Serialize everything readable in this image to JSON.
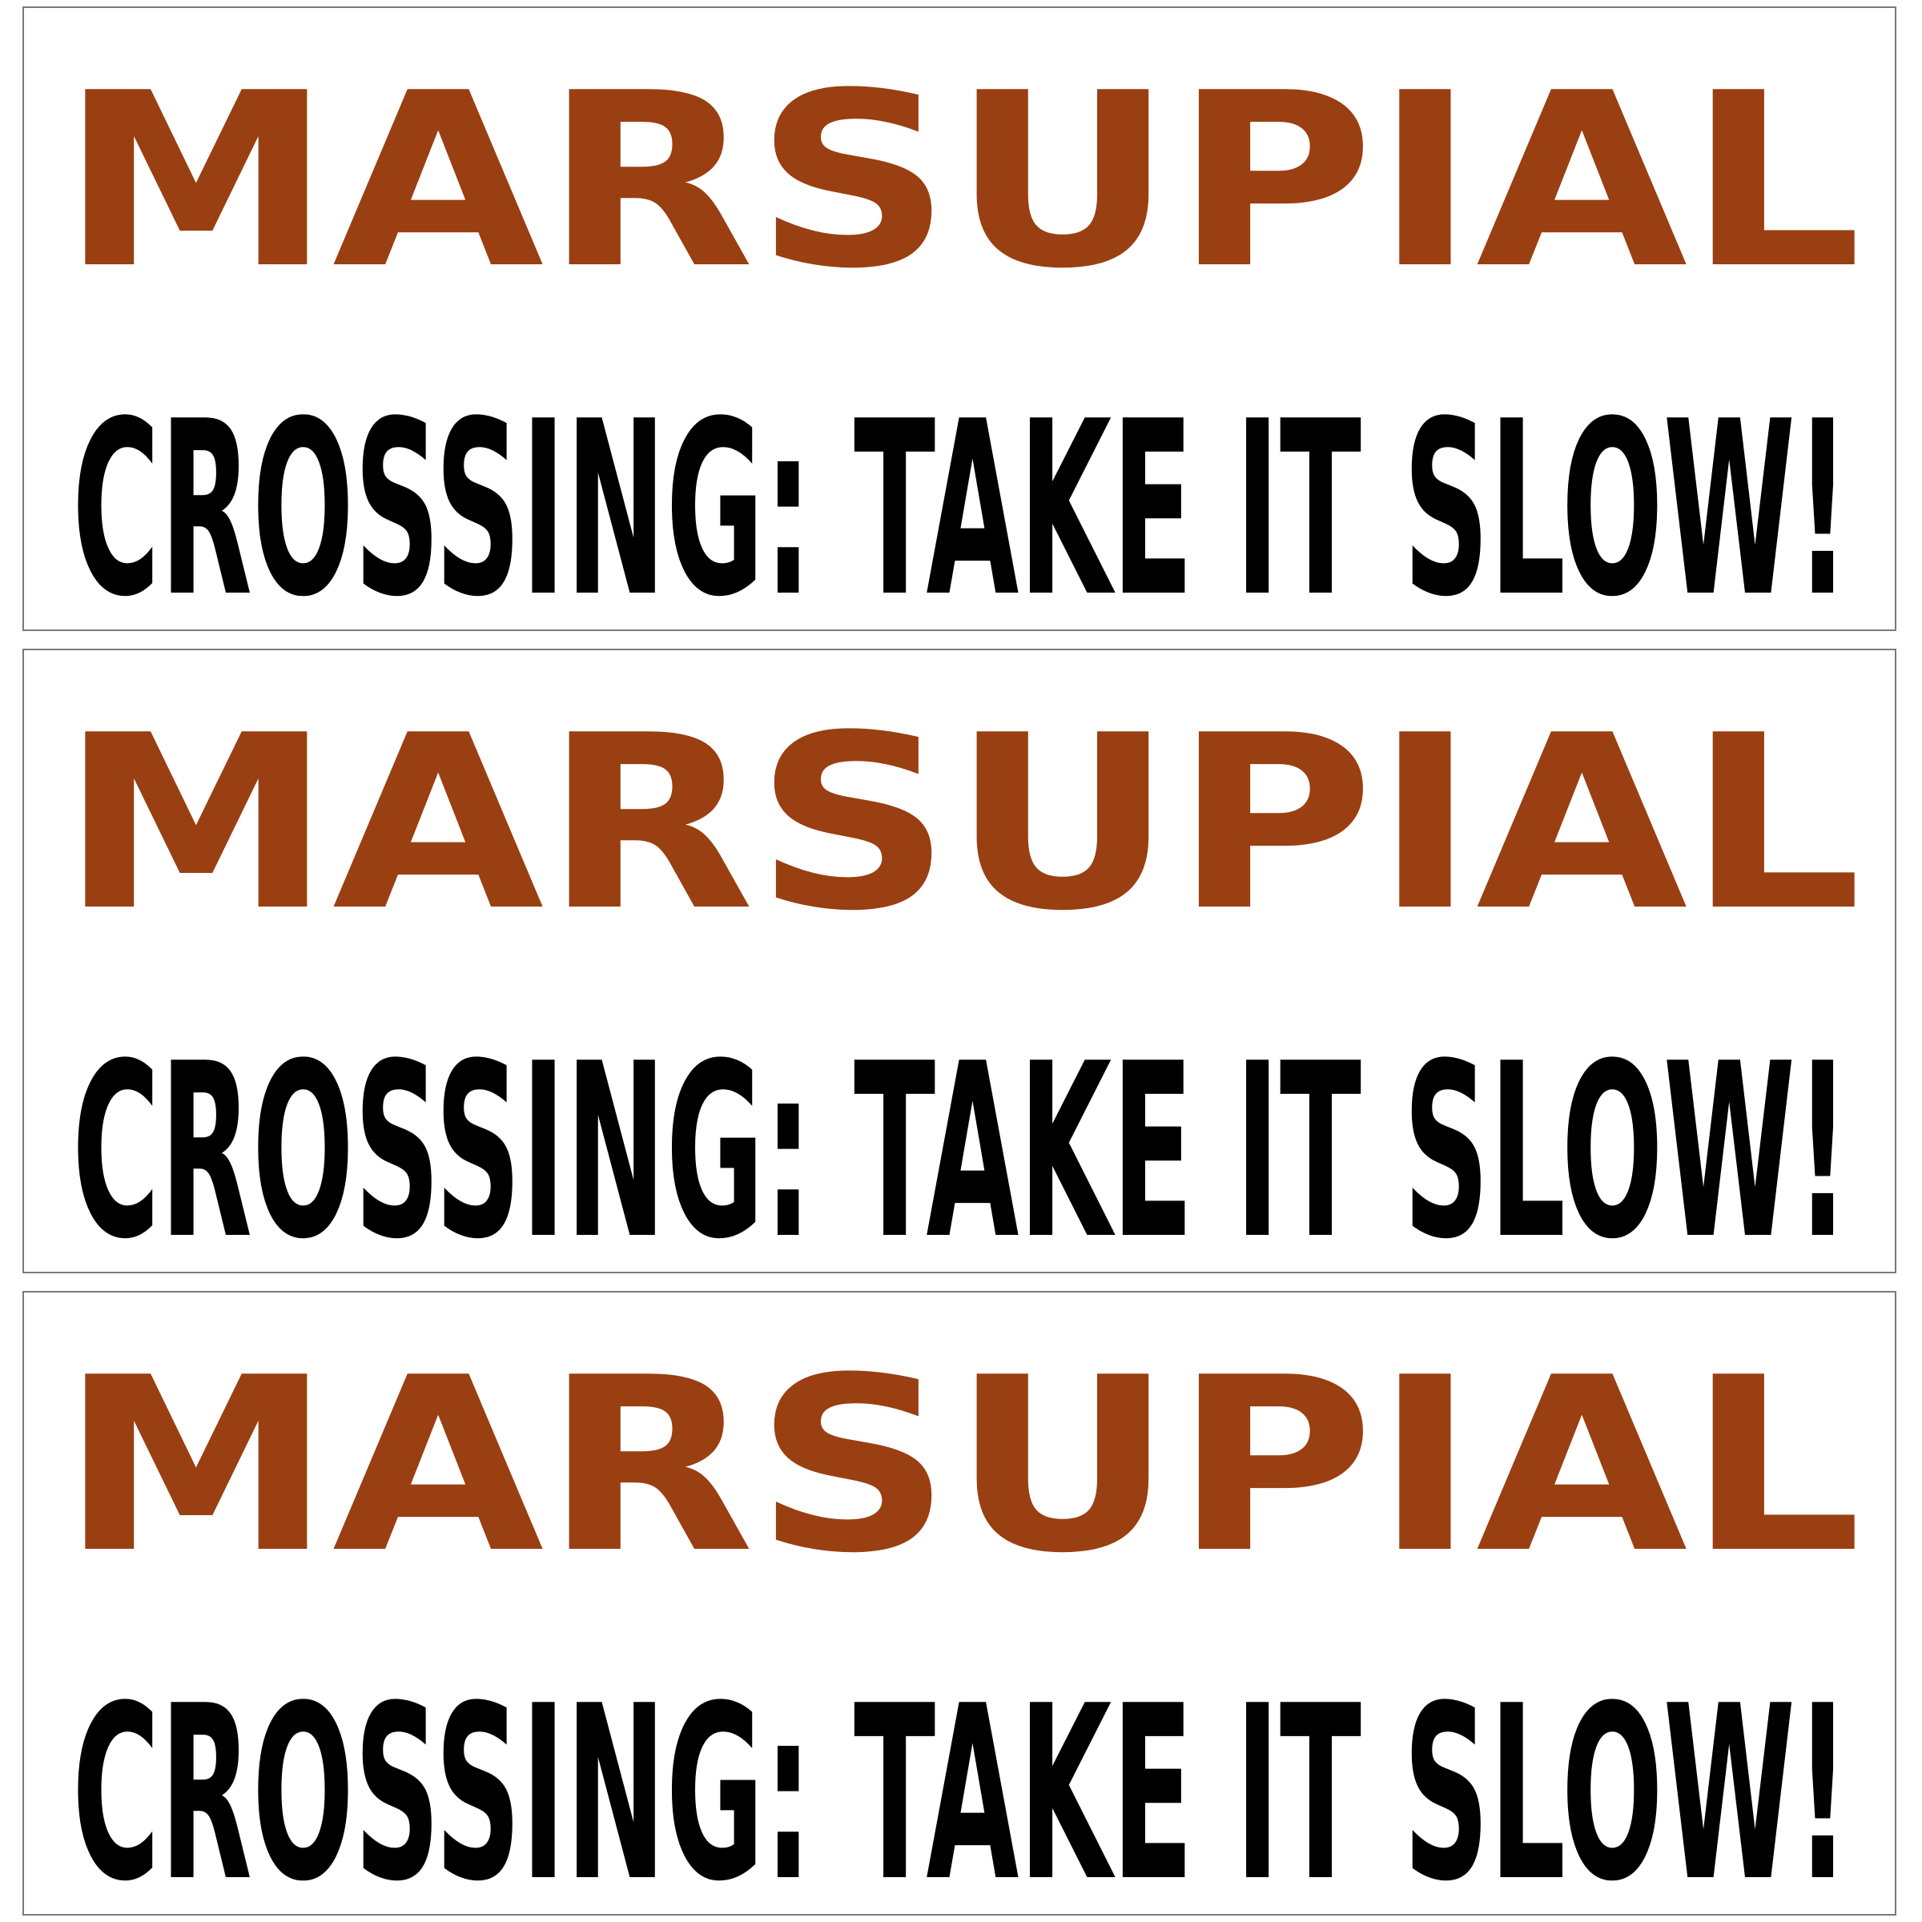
{
  "stickers": [
    {
      "line1": "MARSUPIAL",
      "line2": "CROSSING: TAKE IT SLOW!"
    },
    {
      "line1": "MARSUPIAL",
      "line2": "CROSSING: TAKE IT SLOW!"
    },
    {
      "line1": "MARSUPIAL",
      "line2": "CROSSING: TAKE IT SLOW!"
    }
  ],
  "colors": {
    "line1": "#9a3f12",
    "line2": "#000000",
    "border": "#7a7a7a",
    "background": "#ffffff"
  }
}
